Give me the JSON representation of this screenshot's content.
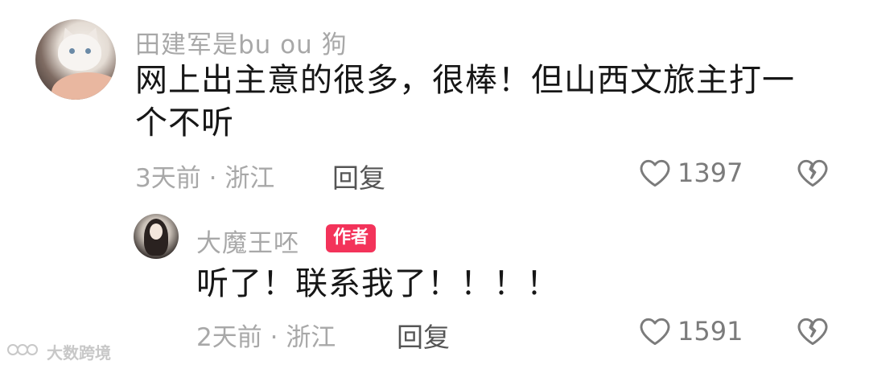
{
  "comment": {
    "username": "田建军是bu ou 狗",
    "text_line1": "网上出主意的很多，很棒！但山西文旅主打一",
    "text_line2": "个不听",
    "time": "3天前",
    "separator": "·",
    "location": "浙江",
    "reply_label": "回复",
    "like_count": "1397"
  },
  "reply": {
    "username": "大魔王呸",
    "badge": "作者",
    "text": "听了！联系我了！！！！",
    "time": "2天前",
    "separator": "·",
    "location": "浙江",
    "reply_label": "回复",
    "like_count": "1591"
  },
  "watermark": {
    "text": "大数跨境"
  },
  "colors": {
    "badge": "#f3335a",
    "meta": "#a8a8a8",
    "text": "#161616"
  },
  "icons": [
    "heart-outline-icon",
    "broken-heart-icon"
  ]
}
